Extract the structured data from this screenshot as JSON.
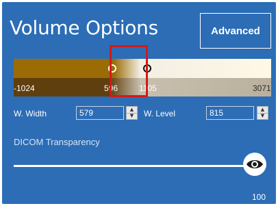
{
  "panel": {
    "title": "Volume Options",
    "advanced_button": "Advanced"
  },
  "window_level_bar": {
    "min_label": "-1024",
    "low_label": "596",
    "high_label": "1105",
    "max_label": "3071"
  },
  "fields": {
    "width_label": "W. Width",
    "width_value": "579",
    "level_label": "W. Level",
    "level_value": "815"
  },
  "transparency": {
    "label": "DICOM Transparency",
    "value": "100",
    "thumb_icon": "eye-icon"
  },
  "colors": {
    "panel_bg": "#2c6db6",
    "highlight": "#d11a1a"
  }
}
